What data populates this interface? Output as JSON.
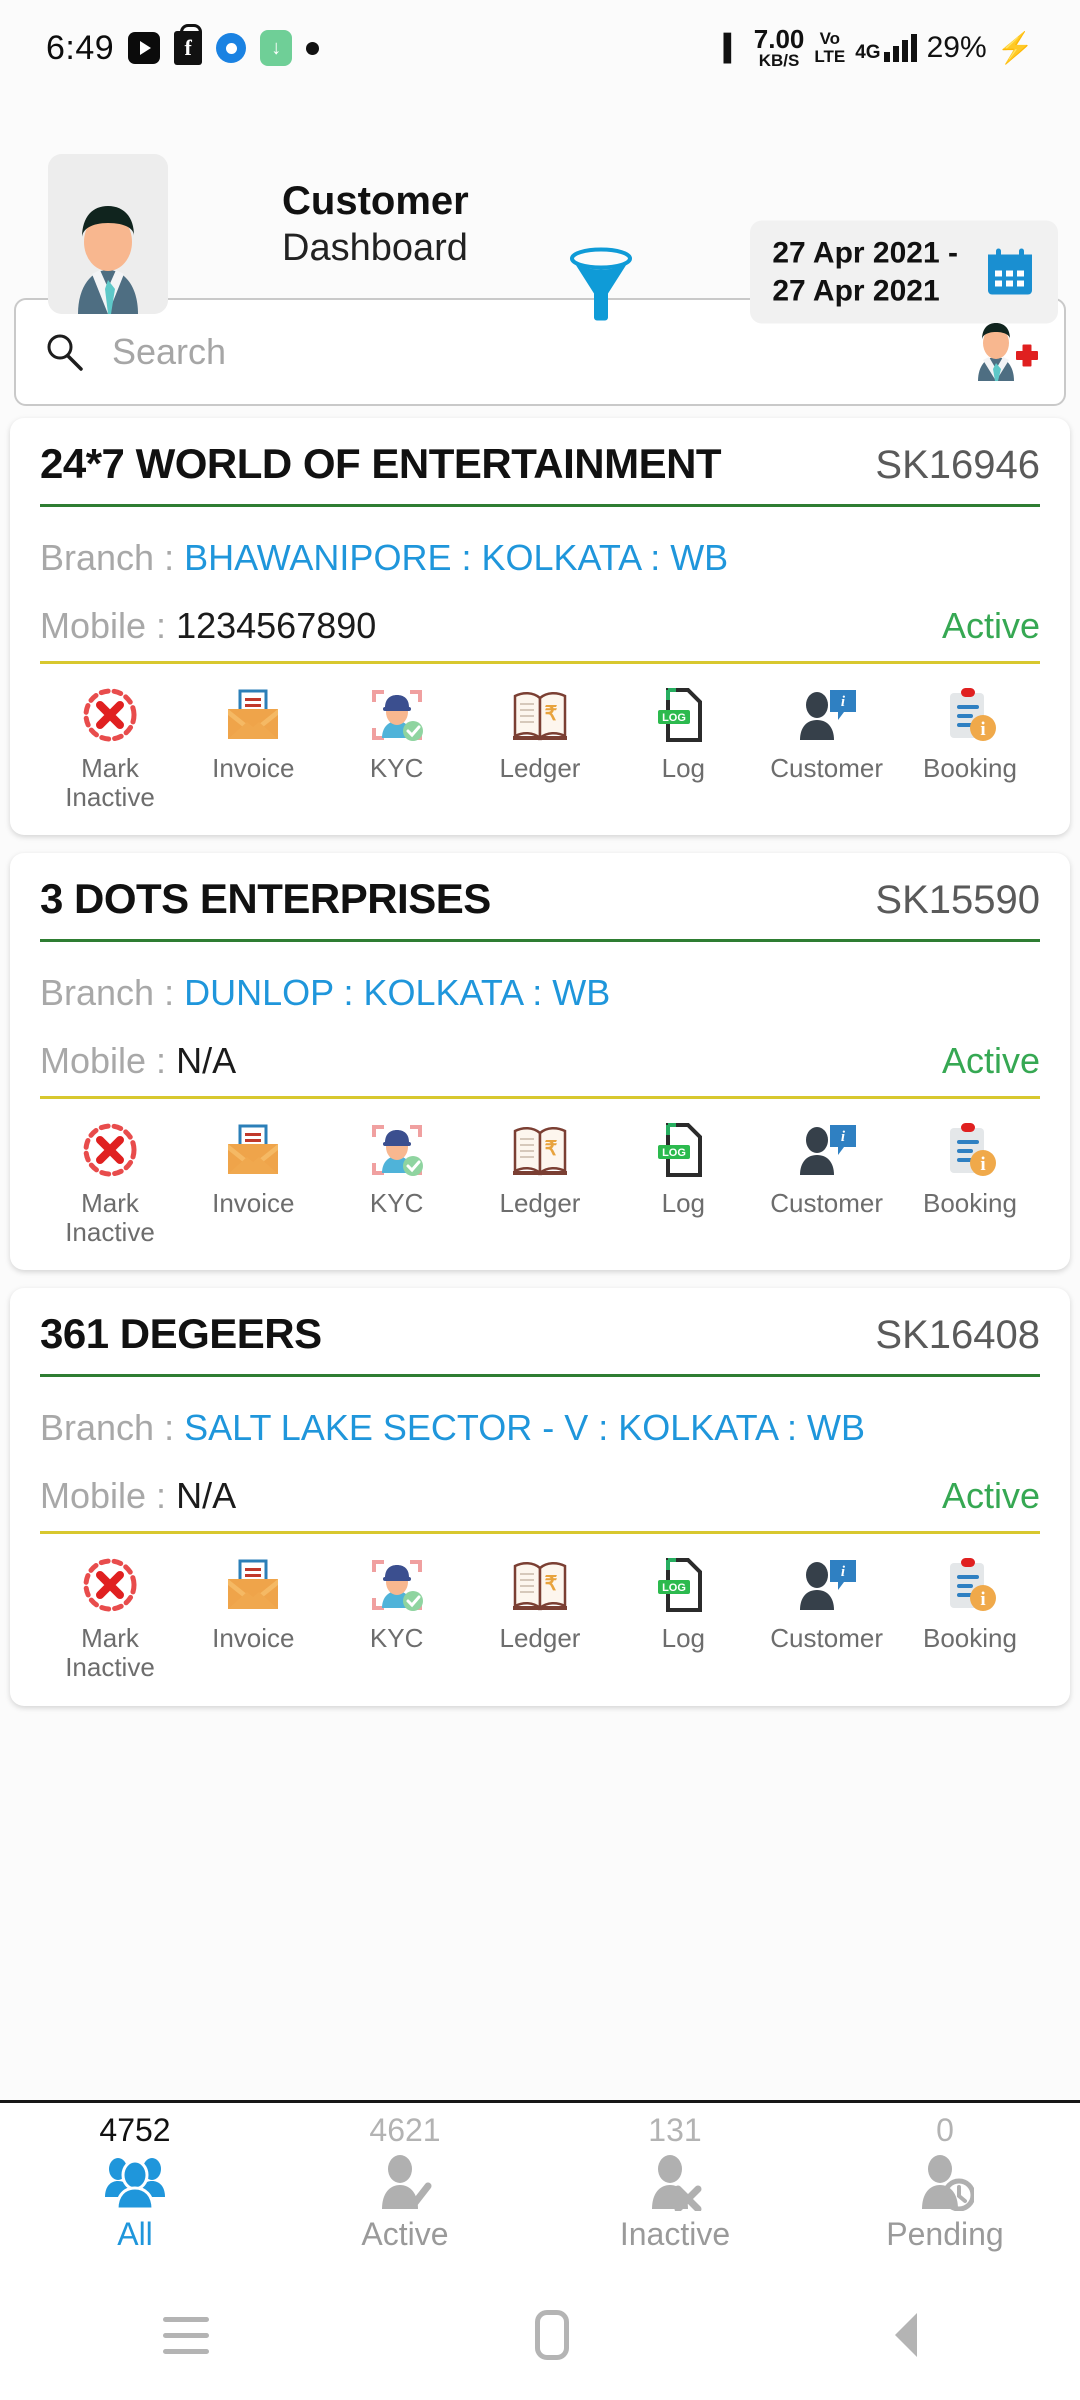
{
  "statusbar": {
    "time": "6:49",
    "icons": [
      "youtube-icon",
      "flipkart-icon",
      "messenger-icon",
      "download-icon",
      "dot-icon"
    ],
    "vibrate_icon": "vibrate-icon",
    "net_speed_value": "7.00",
    "net_speed_unit": "KB/S",
    "volte_line1": "Vo",
    "volte_line2": "LTE",
    "network": "4G",
    "battery": "29%",
    "charging_icon": "bolt-icon"
  },
  "header": {
    "avatar": "user-avatar",
    "title": "Customer",
    "subtitle": "Dashboard",
    "filter_icon": "filter-funnel-icon",
    "date_from": "27 Apr 2021",
    "date_separator": "-",
    "date_to": "27 Apr 2021",
    "calendar_icon": "calendar-icon"
  },
  "search": {
    "icon": "search-icon",
    "placeholder": "Search",
    "value": "",
    "add_customer_icon": "add-user-icon"
  },
  "actions": [
    {
      "icon": "mark-inactive-icon",
      "label": "Mark\nInactive",
      "label_line1": "Mark",
      "label_line2": "Inactive"
    },
    {
      "icon": "invoice-icon",
      "label": "Invoice"
    },
    {
      "icon": "kyc-icon",
      "label": "KYC"
    },
    {
      "icon": "ledger-icon",
      "label": "Ledger"
    },
    {
      "icon": "log-icon",
      "label": "Log"
    },
    {
      "icon": "customer-info-icon",
      "label": "Customer"
    },
    {
      "icon": "booking-icon",
      "label": "Booking"
    }
  ],
  "labels": {
    "branch": "Branch :",
    "mobile": "Mobile :"
  },
  "customers": [
    {
      "name": "24*7 WORLD OF ENTERTAINMENT",
      "code": "SK16946",
      "branch": "BHAWANIPORE : KOLKATA : WB",
      "mobile": "1234567890",
      "status": "Active"
    },
    {
      "name": "3 DOTS ENTERPRISES",
      "code": "SK15590",
      "branch": "DUNLOP : KOLKATA : WB",
      "mobile": "N/A",
      "status": "Active"
    },
    {
      "name": "361 DEGEERS",
      "code": "SK16408",
      "branch": "SALT LAKE SECTOR - V : KOLKATA : WB",
      "mobile": "N/A",
      "status": "Active"
    }
  ],
  "tabs": [
    {
      "count": "4752",
      "label": "All",
      "icon": "group-icon",
      "selected": true
    },
    {
      "count": "4621",
      "label": "Active",
      "icon": "user-check-icon",
      "selected": false
    },
    {
      "count": "131",
      "label": "Inactive",
      "icon": "user-x-icon",
      "selected": false
    },
    {
      "count": "0",
      "label": "Pending",
      "icon": "user-clock-icon",
      "selected": false
    }
  ],
  "navbar": {
    "recents": "recents-icon",
    "home": "home-icon",
    "back": "back-icon"
  },
  "colors": {
    "accent_blue": "#1f96db",
    "active_green": "#36a853",
    "rule_green": "#2e7d32",
    "rule_yellow": "#d8c82e",
    "label_grey": "#a8a8a8"
  }
}
